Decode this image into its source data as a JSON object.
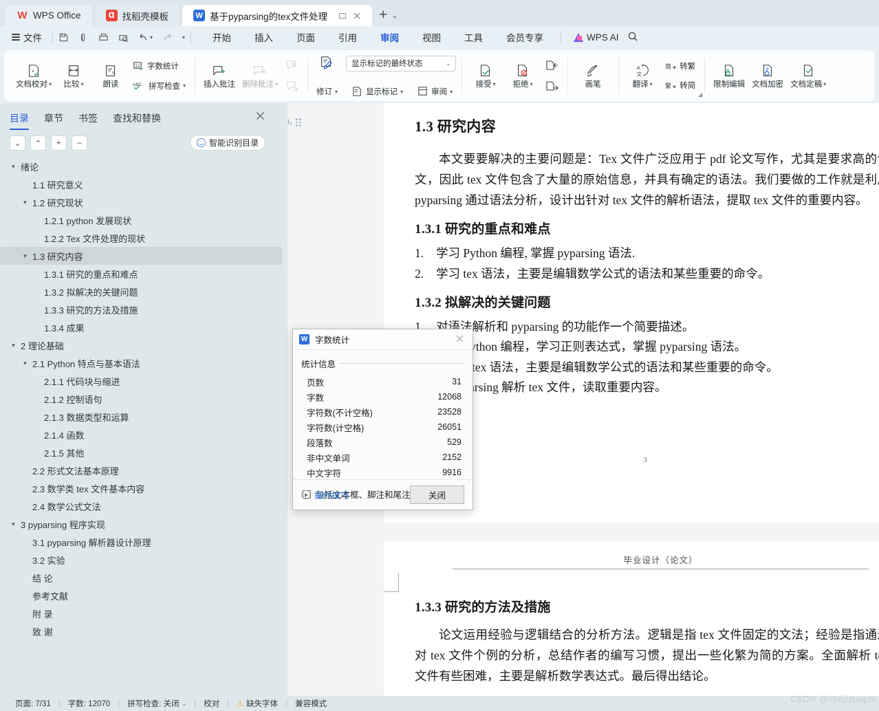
{
  "tabbar": {
    "tabs": [
      {
        "label": "WPS Office",
        "icon": "wps-logo-icon",
        "kind": "home"
      },
      {
        "label": "找稻壳模板",
        "icon": "docer-icon",
        "kind": "normal"
      },
      {
        "label": "基于pyparsing的tex文件处理",
        "icon": "word-doc-icon",
        "kind": "active"
      }
    ],
    "new_tab_label": "+",
    "tab_list_caret": "⌄"
  },
  "menubar": {
    "file_label": "文件",
    "quick_icons": [
      "save-icon",
      "cloud-save-icon",
      "print-icon",
      "print-preview-icon",
      "undo-icon",
      "redo-icon",
      "customize-caret-icon"
    ],
    "items": [
      {
        "label": "开始",
        "active": false
      },
      {
        "label": "插入",
        "active": false
      },
      {
        "label": "页面",
        "active": false
      },
      {
        "label": "引用",
        "active": false
      },
      {
        "label": "审阅",
        "active": true
      },
      {
        "label": "视图",
        "active": false
      },
      {
        "label": "工具",
        "active": false
      },
      {
        "label": "会员专享",
        "active": false
      }
    ],
    "ai_label": "WPS AI",
    "search_icon": "search-icon"
  },
  "ribbon": {
    "groups": [
      {
        "name": "proofing",
        "big": [
          {
            "label": "文档校对",
            "icon": "doc-proofread-icon",
            "caret": true
          },
          {
            "label": "比较",
            "icon": "compare-icon",
            "caret": true
          },
          {
            "label": "朗读",
            "icon": "read-aloud-icon",
            "caret": false
          }
        ],
        "stack": [
          {
            "label": "字数统计",
            "icon": "word-count-icon",
            "caret": false
          },
          {
            "label": "拼写检查",
            "icon": "spell-check-icon",
            "caret": true
          }
        ]
      },
      {
        "name": "comments",
        "big": [
          {
            "label": "插入批注",
            "icon": "insert-comment-icon",
            "caret": false
          },
          {
            "label": "删除批注",
            "icon": "delete-comment-icon",
            "caret": true,
            "disabled": true
          }
        ],
        "stack": [
          {
            "label": "",
            "icon": "previous-comment-icon",
            "caret": false,
            "disabled": true
          },
          {
            "label": "",
            "icon": "next-comment-icon",
            "caret": false,
            "disabled": true
          }
        ]
      },
      {
        "name": "tracking",
        "big": [
          {
            "label": "修订",
            "icon": "track-changes-icon",
            "caret": true
          }
        ],
        "combo_value": "显示标记的最终状态",
        "combo_caret": "⌄",
        "stack": [
          {
            "label": "显示标记",
            "icon": "show-markup-icon",
            "caret": true
          },
          {
            "label": "审阅",
            "icon": "reviewing-pane-icon",
            "caret": true
          }
        ]
      },
      {
        "name": "changes",
        "big": [
          {
            "label": "接受",
            "icon": "accept-change-icon",
            "caret": true
          },
          {
            "label": "拒绝",
            "icon": "reject-change-icon",
            "caret": true
          }
        ],
        "stack": [
          {
            "label": "",
            "icon": "previous-change-icon",
            "caret": false
          },
          {
            "label": "",
            "icon": "next-change-icon",
            "caret": false
          }
        ]
      },
      {
        "name": "ink",
        "big": [
          {
            "label": "画笔",
            "icon": "pen-icon",
            "caret": false
          }
        ]
      },
      {
        "name": "language",
        "big": [
          {
            "label": "翻译",
            "icon": "translate-icon",
            "caret": true
          }
        ],
        "stack": [
          {
            "label": "转繁",
            "icon": "simplified-to-traditional-icon",
            "caret": false
          },
          {
            "label": "转简",
            "icon": "traditional-to-simplified-icon",
            "caret": false
          }
        ],
        "launcher": "◢"
      },
      {
        "name": "protect",
        "big": [
          {
            "label": "限制编辑",
            "icon": "restrict-editing-icon",
            "caret": false
          },
          {
            "label": "文档加密",
            "icon": "encrypt-doc-icon",
            "caret": false
          },
          {
            "label": "文档定稿",
            "icon": "finalize-doc-icon",
            "caret": true
          }
        ]
      }
    ]
  },
  "sidebar": {
    "tabs": [
      {
        "label": "目录",
        "active": true
      },
      {
        "label": "章节",
        "active": false
      },
      {
        "label": "书签",
        "active": false
      },
      {
        "label": "查找和替换",
        "active": false
      }
    ],
    "close_icon": "close-icon",
    "controls": [
      {
        "icon": "chevron-down-icon",
        "glyph": "⌄"
      },
      {
        "icon": "chevron-up-icon",
        "glyph": "⌃"
      },
      {
        "icon": "expand-plus-icon",
        "glyph": "+"
      },
      {
        "icon": "collapse-minus-icon",
        "glyph": "–"
      }
    ],
    "smart_button": {
      "label": "智能识别目录",
      "icon": "smart-detect-icon"
    },
    "outline": [
      {
        "label": "绪论",
        "indent": 0,
        "twisty": "▼",
        "selected": false
      },
      {
        "label": "1.1  研究意义",
        "indent": 1,
        "twisty": "",
        "selected": false
      },
      {
        "label": "1.2  研究现状",
        "indent": 1,
        "twisty": "▼",
        "selected": false
      },
      {
        "label": "1.2.1 python 发展现状",
        "indent": 2,
        "twisty": "",
        "selected": false
      },
      {
        "label": "1.2.2 Tex 文件处理的现状",
        "indent": 2,
        "twisty": "",
        "selected": false
      },
      {
        "label": "1.3  研究内容",
        "indent": 1,
        "twisty": "▼",
        "selected": true
      },
      {
        "label": "1.3.1  研究的重点和难点",
        "indent": 2,
        "twisty": "",
        "selected": false
      },
      {
        "label": "1.3.2  拟解决的关键问题",
        "indent": 2,
        "twisty": "",
        "selected": false
      },
      {
        "label": "1.3.3  研究的方法及措施",
        "indent": 2,
        "twisty": "",
        "selected": false
      },
      {
        "label": "1.3.4 成果",
        "indent": 2,
        "twisty": "",
        "selected": false
      },
      {
        "label": "2  理论基础",
        "indent": 0,
        "twisty": "▼",
        "selected": false
      },
      {
        "label": "2.1 Python 特点与基本语法",
        "indent": 1,
        "twisty": "▼",
        "selected": false
      },
      {
        "label": "2.1.1 代码块与缩进",
        "indent": 2,
        "twisty": "",
        "selected": false
      },
      {
        "label": "2.1.2 控制语句",
        "indent": 2,
        "twisty": "",
        "selected": false
      },
      {
        "label": "2.1.3 数据类型和运算",
        "indent": 2,
        "twisty": "",
        "selected": false
      },
      {
        "label": "2.1.4 函数",
        "indent": 2,
        "twisty": "",
        "selected": false
      },
      {
        "label": "2.1.5 其他",
        "indent": 2,
        "twisty": "",
        "selected": false
      },
      {
        "label": "2.2 形式文法基本原理",
        "indent": 1,
        "twisty": "",
        "selected": false
      },
      {
        "label": "2.3 数学类 tex 文件基本内容",
        "indent": 1,
        "twisty": "",
        "selected": false
      },
      {
        "label": "2.4  数学公式文法",
        "indent": 1,
        "twisty": "",
        "selected": false
      },
      {
        "label": "3 pyparsing  程序实现",
        "indent": 0,
        "twisty": "▼",
        "selected": false
      },
      {
        "label": "3.1 pyparsing 解析器设计原理",
        "indent": 1,
        "twisty": "",
        "selected": false
      },
      {
        "label": "3.2  实验",
        "indent": 1,
        "twisty": "",
        "selected": false
      },
      {
        "label": "结  论",
        "indent": 1,
        "twisty": "",
        "selected": false
      },
      {
        "label": "参考文献",
        "indent": 1,
        "twisty": "",
        "selected": false
      },
      {
        "label": "附  录",
        "indent": 1,
        "twisty": "",
        "selected": false
      },
      {
        "label": "致  谢",
        "indent": 1,
        "twisty": "",
        "selected": false
      }
    ]
  },
  "document": {
    "heading_marker": "H₂",
    "h_13": "1.3  研究内容",
    "para_intro": "本文要要解决的主要问题是：Tex 文件广泛应用于 pdf 论文写作，尤其是要求高的论文，因此 tex 文件包含了大量的原始信息，并具有确定的语法。我们要做的工作就是利用 pyparsing 通过语法分析，设计出针对 tex 文件的解析语法，提取 tex 文件的重要内容。",
    "h_131": "1.3.1  研究的重点和难点",
    "list_131": [
      {
        "num": "1.",
        "text": "学习 Python 编程, 掌握 pyparsing 语法."
      },
      {
        "num": "2.",
        "text": "学习 tex 语法，主要是编辑数学公式的语法和某些重要的命令。"
      }
    ],
    "h_132": "1.3.2  拟解决的关键问题",
    "list_132": [
      {
        "num": "1.",
        "text": "对语法解析和 pyparsing 的功能作一个简要描述。"
      },
      {
        "num": "2.",
        "text": "学习 Python 编程，学习正则表达式，掌握 pyparsing 语法。"
      },
      {
        "num": "3.",
        "text": "了解 latex 语法，主要是编辑数学公式的语法和某些重要的命令。"
      },
      {
        "num": "4.",
        "text": "用 pyparsing 解析 tex 文件，读取重要内容。"
      }
    ],
    "page1_number": "3",
    "page2_header": "毕业设计（论文）",
    "h_133": "1.3.3  研究的方法及措施",
    "para_133": "论文运用经验与逻辑结合的分析方法。逻辑是指 tex 文件固定的文法；经验是指通过对 tex 文件个例的分析，总结作者的编写习惯，提出一些化繁为简的方案。全面解析 tex 文件有些困难，主要是解析数学表达式。最后得出结论。"
  },
  "word_count_dialog": {
    "icon": "word-doc-icon",
    "title": "字数统计",
    "close_icon": "close-icon",
    "legend": "统计信息",
    "stats": [
      {
        "label": "页数",
        "value": "31"
      },
      {
        "label": "字数",
        "value": "12068"
      },
      {
        "label": "字符数(不计空格)",
        "value": "23528"
      },
      {
        "label": "字符数(计空格)",
        "value": "26051"
      },
      {
        "label": "段落数",
        "value": "529"
      },
      {
        "label": "非中文单词",
        "value": "2152"
      },
      {
        "label": "中文字符",
        "value": "9916"
      }
    ],
    "checkbox": {
      "label": "包括文本框、脚注和尾注(F)",
      "checked": false
    },
    "tips_label": "操作技巧",
    "tips_icon": "play-circle-icon",
    "close_button": "关闭"
  },
  "statusbar": {
    "page_info": "页面: 7/31",
    "word_info": "字数: 12070",
    "spell_info": "拼写检查: 关闭",
    "spell_caret": "⌄",
    "proof_label": "校对",
    "font_warning": "缺失字体",
    "warning_icon": "warning-triangle-icon",
    "compat_label": "兼容模式"
  },
  "watermark": "CSDN @shejizuopin",
  "colors": {
    "accent": "#2b5fd9",
    "tabbar_bg": "#dee7ee",
    "ribbon_bg": "#e9f0f5",
    "sidebar_bg": "#dee8ea",
    "selected_row": "#cfd6d8",
    "link": "#2b7de0",
    "warning": "#e8a33d"
  }
}
